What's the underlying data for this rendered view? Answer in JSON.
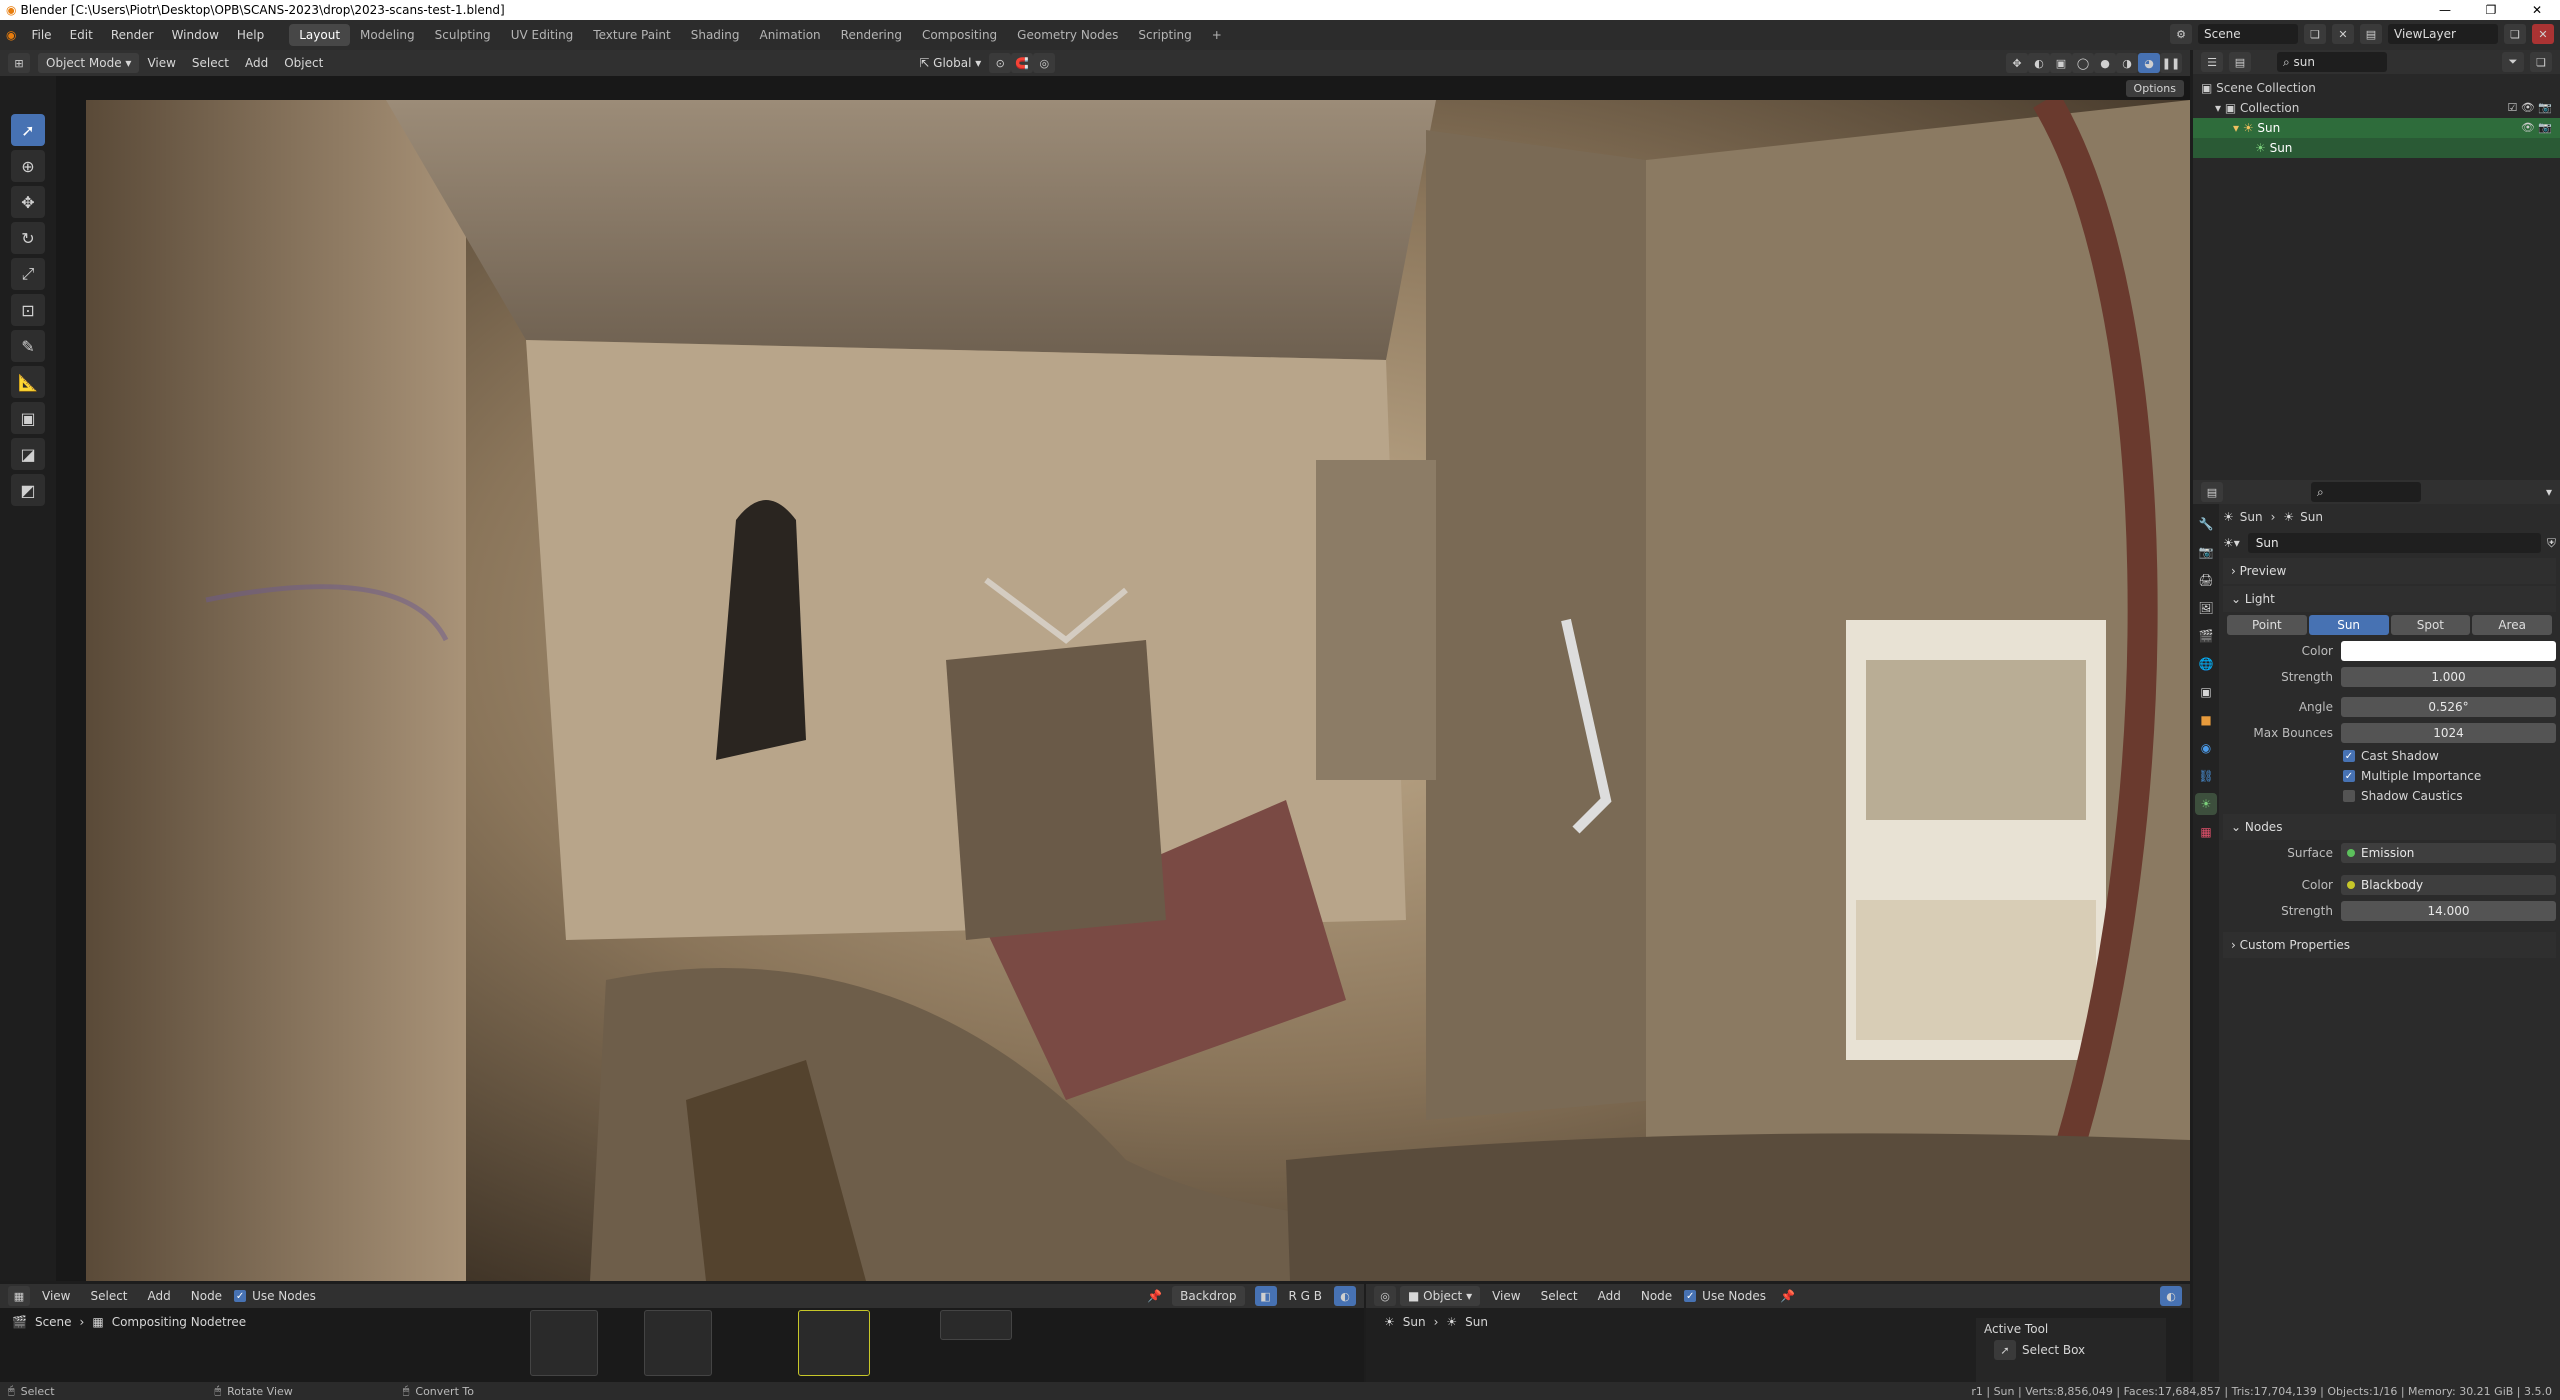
{
  "window": {
    "title": "Blender [C:\\Users\\Piotr\\Desktop\\OPB\\SCANS-2023\\drop\\2023-scans-test-1.blend]"
  },
  "menu": [
    "File",
    "Edit",
    "Render",
    "Window",
    "Help"
  ],
  "workspaces": [
    "Layout",
    "Modeling",
    "Sculpting",
    "UV Editing",
    "Texture Paint",
    "Shading",
    "Animation",
    "Rendering",
    "Compositing",
    "Geometry Nodes",
    "Scripting"
  ],
  "active_workspace": "Layout",
  "scene": {
    "name": "Scene",
    "view_layer": "ViewLayer"
  },
  "viewport_header": {
    "mode": "Object Mode",
    "menus": [
      "View",
      "Select",
      "Add",
      "Object"
    ],
    "transform_orientation": "Global",
    "options": "Options"
  },
  "outliner": {
    "search": "sun",
    "rows": [
      "Scene Collection",
      "Collection",
      "Sun",
      "Sun"
    ]
  },
  "properties": {
    "search": "",
    "breadcrumb": [
      "Sun",
      "Sun"
    ],
    "datablock": "Sun",
    "sections": {
      "preview": "Preview",
      "light": "Light",
      "nodes": "Nodes",
      "custom": "Custom Properties"
    },
    "light_types": [
      "Point",
      "Sun",
      "Spot",
      "Area"
    ],
    "active_light_type": "Sun",
    "color_label": "Color",
    "strength_label": "Strength",
    "strength": "1.000",
    "angle_label": "Angle",
    "angle": "0.526°",
    "bounces_label": "Max Bounces",
    "max_bounces": "1024",
    "cast_shadow": "Cast Shadow",
    "multiple_importance": "Multiple Importance",
    "shadow_caustics": "Shadow Caustics",
    "surface_label": "Surface",
    "surface": "Emission",
    "node_color_label": "Color",
    "node_color": "Blackbody",
    "node_strength_label": "Strength",
    "node_strength": "14.000"
  },
  "compositor": {
    "menus": [
      "View",
      "Select",
      "Add",
      "Node"
    ],
    "use_nodes": "Use Nodes",
    "backdrop": "Backdrop",
    "scene": "Scene",
    "nodetree": "Compositing Nodetree"
  },
  "shader_editor": {
    "type": "Object",
    "menus": [
      "View",
      "Select",
      "Add",
      "Node"
    ],
    "use_nodes": "Use Nodes",
    "breadcrumb": [
      "Sun",
      "Sun"
    ],
    "active_tool": "Active Tool",
    "select_box": "Select Box"
  },
  "status": {
    "select": "Select",
    "rotate": "Rotate View",
    "convert": "Convert To",
    "stats": "r1 | Sun | Verts:8,856,049 | Faces:17,684,857 | Tris:17,704,139 | Objects:1/16 | Memory: 30.21 GiB | 3.5.0"
  },
  "colors": {
    "accent": "#4772b3",
    "active_green": "#2e6c3b",
    "light_color": "#ffffff"
  }
}
